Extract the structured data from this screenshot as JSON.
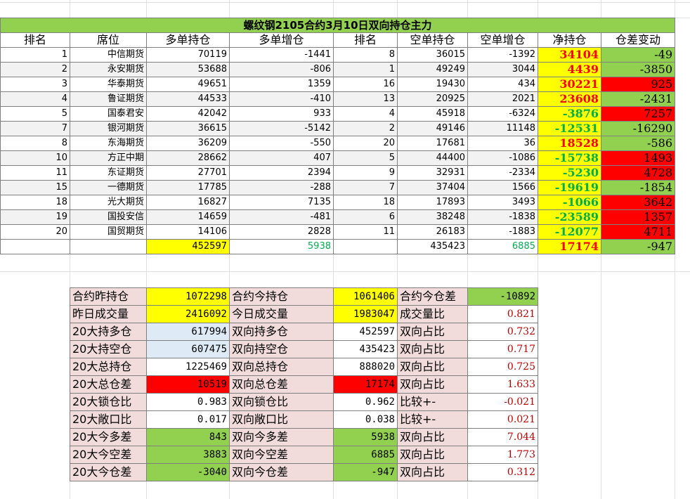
{
  "title": "螺纹钢2105合约3月10日双向持仓主力",
  "headers": [
    "排名",
    "席位",
    "多单持仓",
    "多单增仓",
    "排名",
    "空单持仓",
    "空单增仓",
    "净持仓",
    "仓差变动"
  ],
  "rows": [
    {
      "rank": "1",
      "broker": "中信期货",
      "long": "70119",
      "long_chg": "-1441",
      "srank": "8",
      "short": "36015",
      "short_chg": "-1392",
      "net": "34104",
      "net_color": "red",
      "oi_chg": "-49",
      "oi_bg": "green"
    },
    {
      "rank": "2",
      "broker": "永安期货",
      "long": "53688",
      "long_chg": "-806",
      "srank": "1",
      "short": "49249",
      "short_chg": "3044",
      "net": "4439",
      "net_color": "red",
      "oi_chg": "-3850",
      "oi_bg": "green"
    },
    {
      "rank": "3",
      "broker": "华泰期货",
      "long": "49651",
      "long_chg": "1359",
      "srank": "16",
      "short": "19430",
      "short_chg": "434",
      "net": "30221",
      "net_color": "red",
      "oi_chg": "925",
      "oi_bg": "red"
    },
    {
      "rank": "4",
      "broker": "鲁证期货",
      "long": "44533",
      "long_chg": "-410",
      "srank": "13",
      "short": "20925",
      "short_chg": "2021",
      "net": "23608",
      "net_color": "red",
      "oi_chg": "-2431",
      "oi_bg": "green"
    },
    {
      "rank": "5",
      "broker": "国泰君安",
      "long": "42042",
      "long_chg": "933",
      "srank": "4",
      "short": "45918",
      "short_chg": "-6324",
      "net": "-3876",
      "net_color": "green",
      "oi_chg": "7257",
      "oi_bg": "red"
    },
    {
      "rank": "7",
      "broker": "银河期货",
      "long": "36615",
      "long_chg": "-5142",
      "srank": "2",
      "short": "49146",
      "short_chg": "11148",
      "net": "-12531",
      "net_color": "green",
      "oi_chg": "-16290",
      "oi_bg": "green"
    },
    {
      "rank": "8",
      "broker": "东海期货",
      "long": "36209",
      "long_chg": "-550",
      "srank": "20",
      "short": "17681",
      "short_chg": "36",
      "net": "18528",
      "net_color": "red",
      "oi_chg": "-586",
      "oi_bg": "green"
    },
    {
      "rank": "10",
      "broker": "方正中期",
      "long": "28662",
      "long_chg": "407",
      "srank": "5",
      "short": "44400",
      "short_chg": "-1086",
      "net": "-15738",
      "net_color": "green",
      "oi_chg": "1493",
      "oi_bg": "red"
    },
    {
      "rank": "11",
      "broker": "东证期货",
      "long": "27701",
      "long_chg": "2394",
      "srank": "9",
      "short": "32931",
      "short_chg": "-2334",
      "net": "-5230",
      "net_color": "green",
      "oi_chg": "4728",
      "oi_bg": "red"
    },
    {
      "rank": "15",
      "broker": "一德期货",
      "long": "17785",
      "long_chg": "-288",
      "srank": "7",
      "short": "37404",
      "short_chg": "1566",
      "net": "-19619",
      "net_color": "green",
      "oi_chg": "-1854",
      "oi_bg": "green"
    },
    {
      "rank": "18",
      "broker": "光大期货",
      "long": "16827",
      "long_chg": "7135",
      "srank": "18",
      "short": "17893",
      "short_chg": "3493",
      "net": "-1066",
      "net_color": "green",
      "oi_chg": "3642",
      "oi_bg": "red"
    },
    {
      "rank": "19",
      "broker": "国投安信",
      "long": "14659",
      "long_chg": "-481",
      "srank": "6",
      "short": "38248",
      "short_chg": "-1838",
      "net": "-23589",
      "net_color": "green",
      "oi_chg": "1357",
      "oi_bg": "red"
    },
    {
      "rank": "20",
      "broker": "国贸期货",
      "long": "14106",
      "long_chg": "2828",
      "srank": "11",
      "short": "26183",
      "short_chg": "-1883",
      "net": "-12077",
      "net_color": "green",
      "oi_chg": "4711",
      "oi_bg": "red"
    }
  ],
  "totals": {
    "long": "452597",
    "long_chg": "5938",
    "short": "435423",
    "short_chg": "6885",
    "net": "17174",
    "oi_chg": "-947"
  },
  "summary": [
    {
      "l1": "合约昨持仓",
      "v1": "1072298",
      "b1": "yellow",
      "l2": "合约今持仓",
      "v2": "1061406",
      "b2": "yellow",
      "l3": "合约今仓差",
      "v3": "-10892",
      "b3": "green",
      "s3": "plain"
    },
    {
      "l1": "昨日成交量",
      "v1": "2416092",
      "b1": "yellow",
      "l2": "今日成交量",
      "v2": "1983047",
      "b2": "yellow",
      "l3": "成交量比",
      "v3": "0.821",
      "b3": "white",
      "s3": "serif"
    },
    {
      "l1": "20大持多仓",
      "v1": "617994",
      "b1": "lightblue",
      "l2": "双向持多仓",
      "v2": "452597",
      "b2": "white",
      "l3": "双向占比",
      "v3": "0.732",
      "b3": "white",
      "s3": "serif"
    },
    {
      "l1": "20大持空仓",
      "v1": "607475",
      "b1": "lightblue",
      "l2": "双向持空仓",
      "v2": "435423",
      "b2": "white",
      "l3": "双向占比",
      "v3": "0.717",
      "b3": "white",
      "s3": "serif"
    },
    {
      "l1": "20大总持仓",
      "v1": "1225469",
      "b1": "white",
      "l2": "双向总持仓",
      "v2": "888020",
      "b2": "white",
      "l3": "双向占比",
      "v3": "0.725",
      "b3": "white",
      "s3": "serif"
    },
    {
      "l1": "20大总仓差",
      "v1": "10519",
      "b1": "red",
      "l2": "双向总仓差",
      "v2": "17174",
      "b2": "red",
      "l3": "双向占比",
      "v3": "1.633",
      "b3": "white",
      "s3": "serif"
    },
    {
      "l1": "20大锁仓比",
      "v1": "0.983",
      "b1": "white",
      "l2": "双向锁仓比",
      "v2": "0.962",
      "b2": "white",
      "l3": "比较+-",
      "v3": "-0.021",
      "b3": "white",
      "s3": "serif"
    },
    {
      "l1": "20大敞口比",
      "v1": "0.017",
      "b1": "white",
      "l2": "双向敞口比",
      "v2": "0.038",
      "b2": "white",
      "l3": "比较+-",
      "v3": "0.021",
      "b3": "white",
      "s3": "serif"
    },
    {
      "l1": "20大今多差",
      "v1": "843",
      "b1": "green",
      "l2": "双向今多差",
      "v2": "5938",
      "b2": "green",
      "l3": "双向占比",
      "v3": "7.044",
      "b3": "white",
      "s3": "serif"
    },
    {
      "l1": "20大今空差",
      "v1": "3883",
      "b1": "green",
      "l2": "双向今空差",
      "v2": "6885",
      "b2": "green",
      "l3": "双向占比",
      "v3": "1.773",
      "b3": "white",
      "s3": "serif"
    },
    {
      "l1": "20大今仓差",
      "v1": "-3040",
      "b1": "green",
      "l2": "双向今仓差",
      "v2": "-947",
      "b2": "green",
      "l3": "双向占比",
      "v3": "0.312",
      "b3": "white",
      "s3": "serif"
    }
  ]
}
